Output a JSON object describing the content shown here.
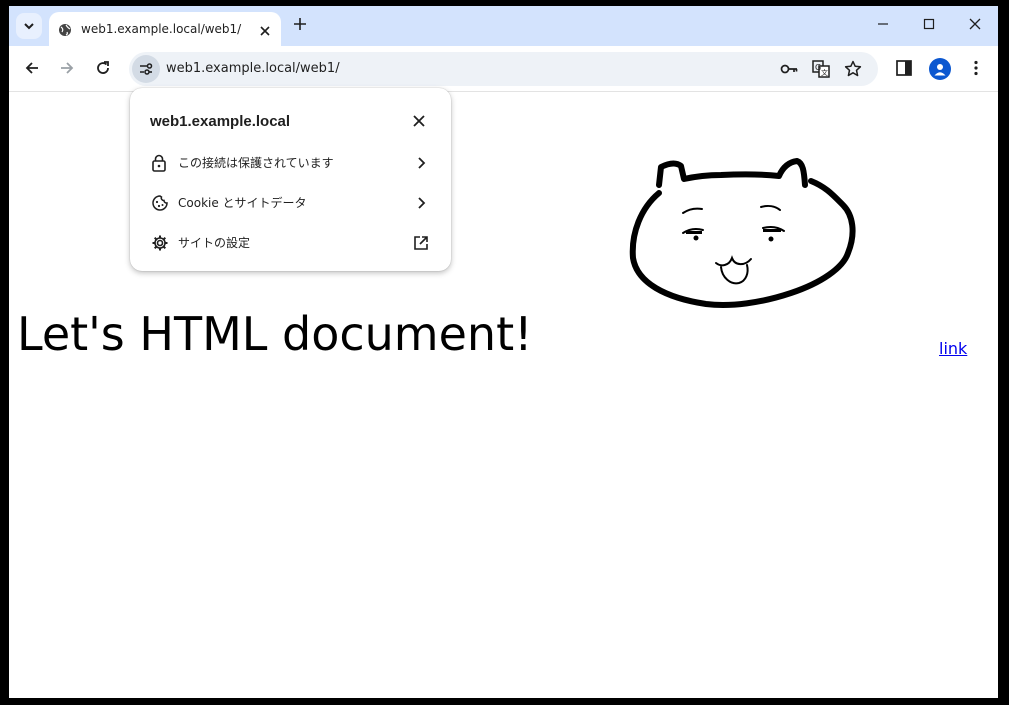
{
  "browser": {
    "tab_title": "web1.example.local/web1/",
    "url": "web1.example.local/web1/"
  },
  "popup": {
    "title": "web1.example.local",
    "items": [
      {
        "label": "この接続は保護されています",
        "icon": "lock-icon",
        "action": "chevron-right-icon"
      },
      {
        "label": "Cookie とサイトデータ",
        "icon": "cookie-icon",
        "action": "chevron-right-icon"
      },
      {
        "label": "サイトの設定",
        "icon": "gear-icon",
        "action": "open-external-icon"
      }
    ]
  },
  "page": {
    "heading": "Let's HTML document!",
    "link": "link"
  },
  "colors": {
    "tabstrip": "#d3e3fd",
    "link": "#0000ee",
    "avatar": "#0b57d0"
  }
}
